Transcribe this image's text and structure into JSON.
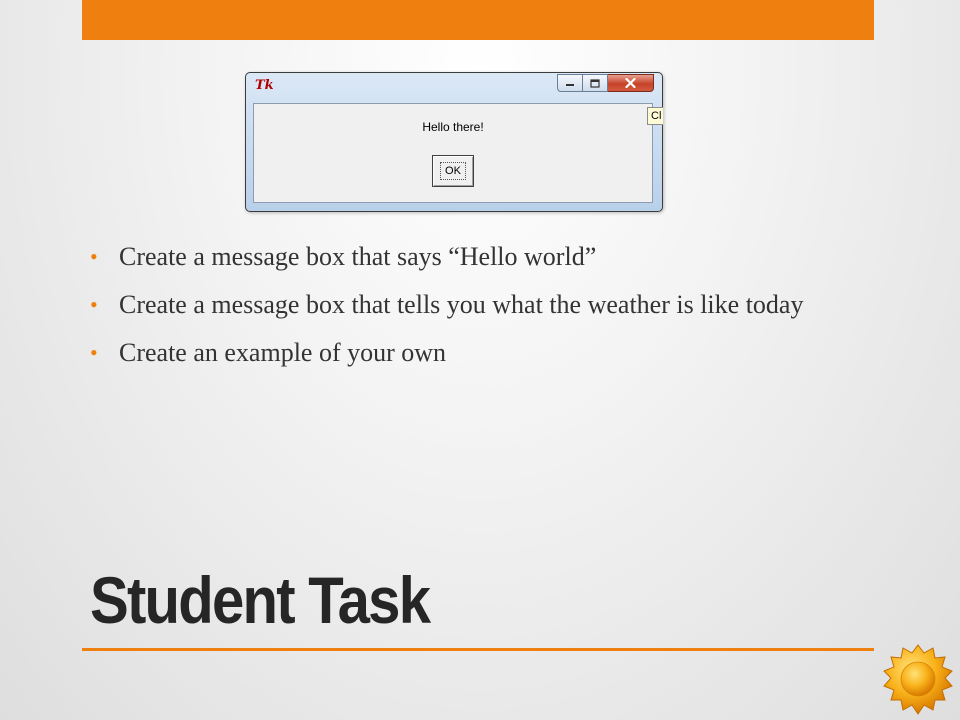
{
  "slide": {
    "title": "Student Task",
    "bullets": [
      "Create a message box that says “Hello world”",
      "Create a message box that tells you what the weather is like today",
      "Create an example of your own"
    ],
    "accent_color": "#ef7f0e"
  },
  "tk_window": {
    "logo_text": "Tk",
    "message": "Hello there!",
    "ok_label": "OK",
    "peek_text": "Cl",
    "icons": {
      "minimize": "minimize-icon",
      "maximize": "maximize-icon",
      "close": "close-icon"
    }
  }
}
